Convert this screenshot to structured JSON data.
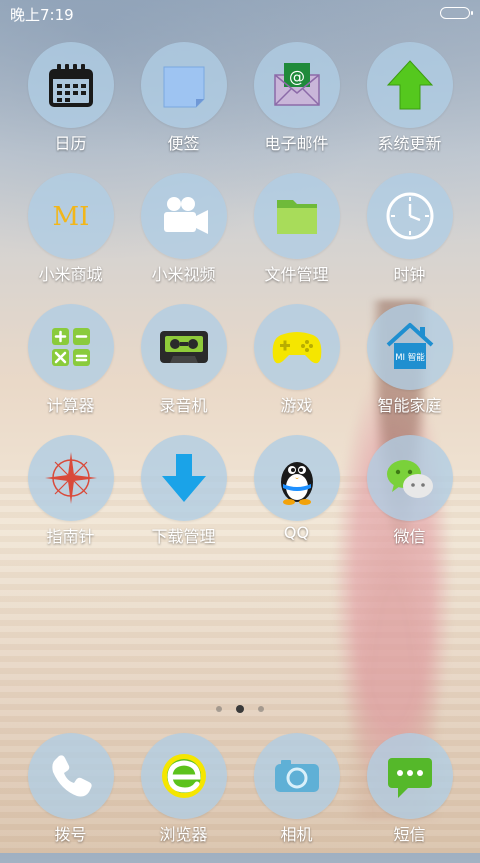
{
  "status_bar": {
    "time": "晚上7:19"
  },
  "apps": [
    {
      "label": "日历",
      "icon": "calendar-icon"
    },
    {
      "label": "便签",
      "icon": "notes-icon"
    },
    {
      "label": "电子邮件",
      "icon": "email-icon"
    },
    {
      "label": "系统更新",
      "icon": "update-icon"
    },
    {
      "label": "小米商城",
      "icon": "mi-store-icon",
      "icon_text": "MI"
    },
    {
      "label": "小米视频",
      "icon": "video-camera-icon"
    },
    {
      "label": "文件管理",
      "icon": "folder-icon"
    },
    {
      "label": "时钟",
      "icon": "clock-icon"
    },
    {
      "label": "计算器",
      "icon": "calculator-icon"
    },
    {
      "label": "录音机",
      "icon": "cassette-icon"
    },
    {
      "label": "游戏",
      "icon": "gamepad-icon"
    },
    {
      "label": "智能家庭",
      "icon": "smart-home-icon",
      "icon_text": "MI 智能"
    },
    {
      "label": "指南针",
      "icon": "compass-icon"
    },
    {
      "label": "下载管理",
      "icon": "download-icon"
    },
    {
      "label": "QQ",
      "icon": "qq-penguin-icon"
    },
    {
      "label": "微信",
      "icon": "wechat-icon"
    }
  ],
  "pager": {
    "count": 3,
    "active": 2
  },
  "dock": [
    {
      "label": "拨号",
      "icon": "phone-icon"
    },
    {
      "label": "浏览器",
      "icon": "browser-icon"
    },
    {
      "label": "相机",
      "icon": "camera-icon"
    },
    {
      "label": "短信",
      "icon": "message-icon"
    }
  ],
  "colors": {
    "circle": "#b0cde4",
    "label": "#ffffff",
    "accent_green": "#55c81e",
    "accent_yellow": "#f5e600"
  }
}
